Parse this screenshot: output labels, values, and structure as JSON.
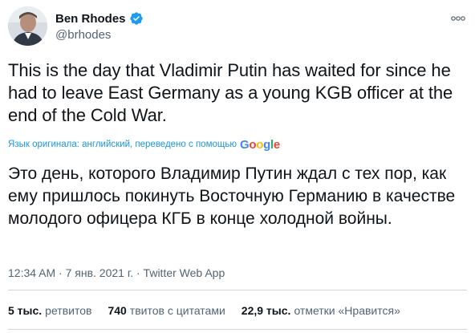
{
  "author": {
    "display_name": "Ben Rhodes",
    "handle": "@brhodes",
    "verified": true,
    "avatar_icon": "profile-photo",
    "more_icon": "more-horizontal-icon"
  },
  "tweet": {
    "text": "This is the day that Vladimir Putin has waited for since he had to leave East Germany as a young KGB officer at the end of the Cold War.",
    "translation_notice": "Язык оригинала: английский, переведено с помощью",
    "translation_provider": {
      "g1": "G",
      "o1": "o",
      "o2": "o",
      "g2": "g",
      "l": "l",
      "e": "e"
    },
    "translated_text": "Это день, которого Владимир Путин ждал с тех пор, как ему пришлось покинуть Восточную Германию в качестве молодого офицера КГБ в конце холодной войны.",
    "timestamp": "12:34 AM · 7 янв. 2021 г. · Twitter Web App"
  },
  "stats": {
    "retweets": {
      "count": "5 тыс.",
      "label": "ретвитов"
    },
    "quotes": {
      "count": "740",
      "label": "твитов с цитатами"
    },
    "likes": {
      "count": "22,9 тыс.",
      "label": "отметки «Нравится»"
    }
  },
  "colors": {
    "text": "#0f1419",
    "secondary": "#536471",
    "link": "#1b95e0",
    "verified": "#1d9bf0",
    "divider": "#cfd9de"
  }
}
